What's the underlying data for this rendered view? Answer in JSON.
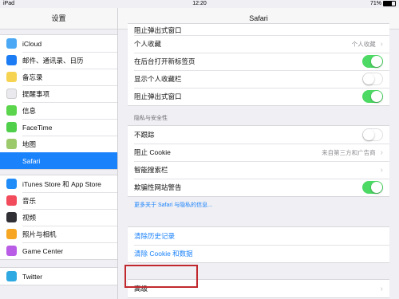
{
  "status": {
    "device": "iPad",
    "time": "12:20",
    "battery": "71%"
  },
  "left": {
    "title": "设置",
    "groups": [
      [
        {
          "label": "iCloud",
          "icon": "cloud-icon",
          "color": "#4ba8f5"
        },
        {
          "label": "邮件、通讯录、日历",
          "icon": "mail-icon",
          "color": "#1b7cf4"
        },
        {
          "label": "备忘录",
          "icon": "notes-icon",
          "color": "#f6d350"
        },
        {
          "label": "提醒事项",
          "icon": "reminders-icon",
          "color": "#e9e9ee"
        },
        {
          "label": "信息",
          "icon": "messages-icon",
          "color": "#5bd54c"
        },
        {
          "label": "FaceTime",
          "icon": "facetime-icon",
          "color": "#4fcf4a"
        },
        {
          "label": "地图",
          "icon": "maps-icon",
          "color": "#9cc96a"
        },
        {
          "label": "Safari",
          "icon": "safari-icon",
          "color": "#1a82fb",
          "selected": true
        }
      ],
      [
        {
          "label": "iTunes Store 和 App Store",
          "icon": "app-store-icon",
          "color": "#1f8cf7"
        },
        {
          "label": "音乐",
          "icon": "music-icon",
          "color": "#f24b5b"
        },
        {
          "label": "视频",
          "icon": "video-icon",
          "color": "#2f2f35"
        },
        {
          "label": "照片与相机",
          "icon": "photos-icon",
          "color": "#f6a623"
        },
        {
          "label": "Game Center",
          "icon": "game-center-icon",
          "color": "#b95ce6"
        }
      ],
      [
        {
          "label": "Twitter",
          "icon": "twitter-icon",
          "color": "#2fa9e1"
        }
      ]
    ]
  },
  "right": {
    "title": "Safari",
    "top_rows": [
      {
        "label": "阻止弹出式窗口",
        "type": "partial"
      },
      {
        "label": "个人收藏",
        "value": "个人收藏",
        "type": "chevron"
      },
      {
        "label": "在后台打开新标签页",
        "type": "toggle",
        "on": true
      },
      {
        "label": "显示个人收藏栏",
        "type": "toggle",
        "on": false
      },
      {
        "label": "阻止弹出式窗口",
        "type": "toggle",
        "on": true
      }
    ],
    "privacy_title": "隐私与安全性",
    "privacy_rows": [
      {
        "label": "不跟踪",
        "type": "toggle",
        "on": false
      },
      {
        "label": "阻止 Cookie",
        "value": "来自第三方和广告商",
        "type": "chevron"
      },
      {
        "label": "智能搜索栏",
        "type": "chevron"
      },
      {
        "label": "欺骗性网站警告",
        "type": "toggle",
        "on": true
      }
    ],
    "privacy_note": "更多关于 Safari 与隐私的信息...",
    "clear_rows": [
      "清除历史记录",
      "清除 Cookie 和数据"
    ],
    "advanced": "高级"
  }
}
